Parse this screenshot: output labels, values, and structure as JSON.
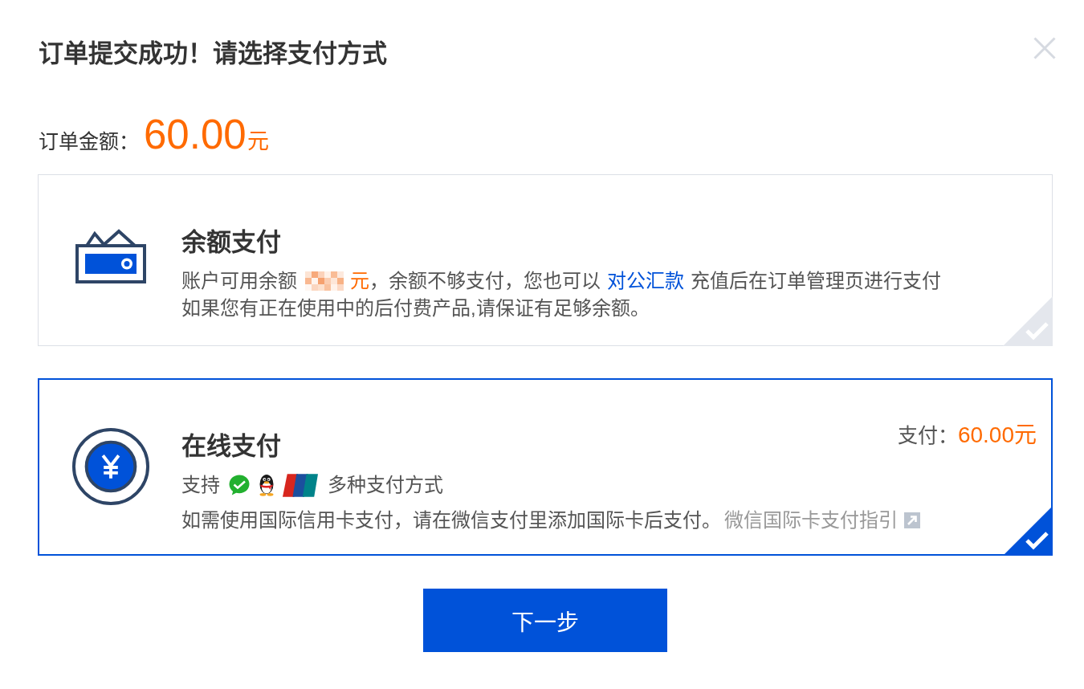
{
  "dialog": {
    "title": "订单提交成功！请选择支付方式",
    "order_amount": {
      "label": "订单金额：",
      "amount": "60.00",
      "unit": "元"
    },
    "payment_methods": [
      {
        "kind": "balance",
        "title": "余额支付",
        "selected": false,
        "lines": [
          {
            "kind": "text",
            "segments": [
              {
                "kind": "plain",
                "text": "账户可用余额"
              },
              {
                "kind": "masked"
              },
              {
                "kind": "accent",
                "text": "元"
              },
              {
                "kind": "plain",
                "text": "，余额不够支付，您也可以"
              },
              {
                "kind": "link",
                "text": "对公汇款"
              },
              {
                "kind": "plain",
                "text": "充值后在订单管理页进行支付"
              }
            ]
          },
          {
            "kind": "text",
            "segments": [
              {
                "kind": "plain",
                "text": "如果您有正在使用中的后付费产品,请保证有足够余额。"
              }
            ]
          }
        ]
      },
      {
        "kind": "online",
        "title": "在线支付",
        "selected": true,
        "pay_label": "支付：",
        "pay_amount": "60.00元",
        "lines": [
          {
            "kind": "supported",
            "before": "支持",
            "after": "多种支付方式"
          },
          {
            "kind": "text",
            "segments": [
              {
                "kind": "plain",
                "text": "如需使用国际信用卡支付，请在微信支付里添加国际卡后支付。"
              },
              {
                "kind": "external_link",
                "text": "微信国际卡支付指引"
              }
            ]
          }
        ]
      }
    ],
    "next_button": {
      "label": "下一步"
    }
  }
}
